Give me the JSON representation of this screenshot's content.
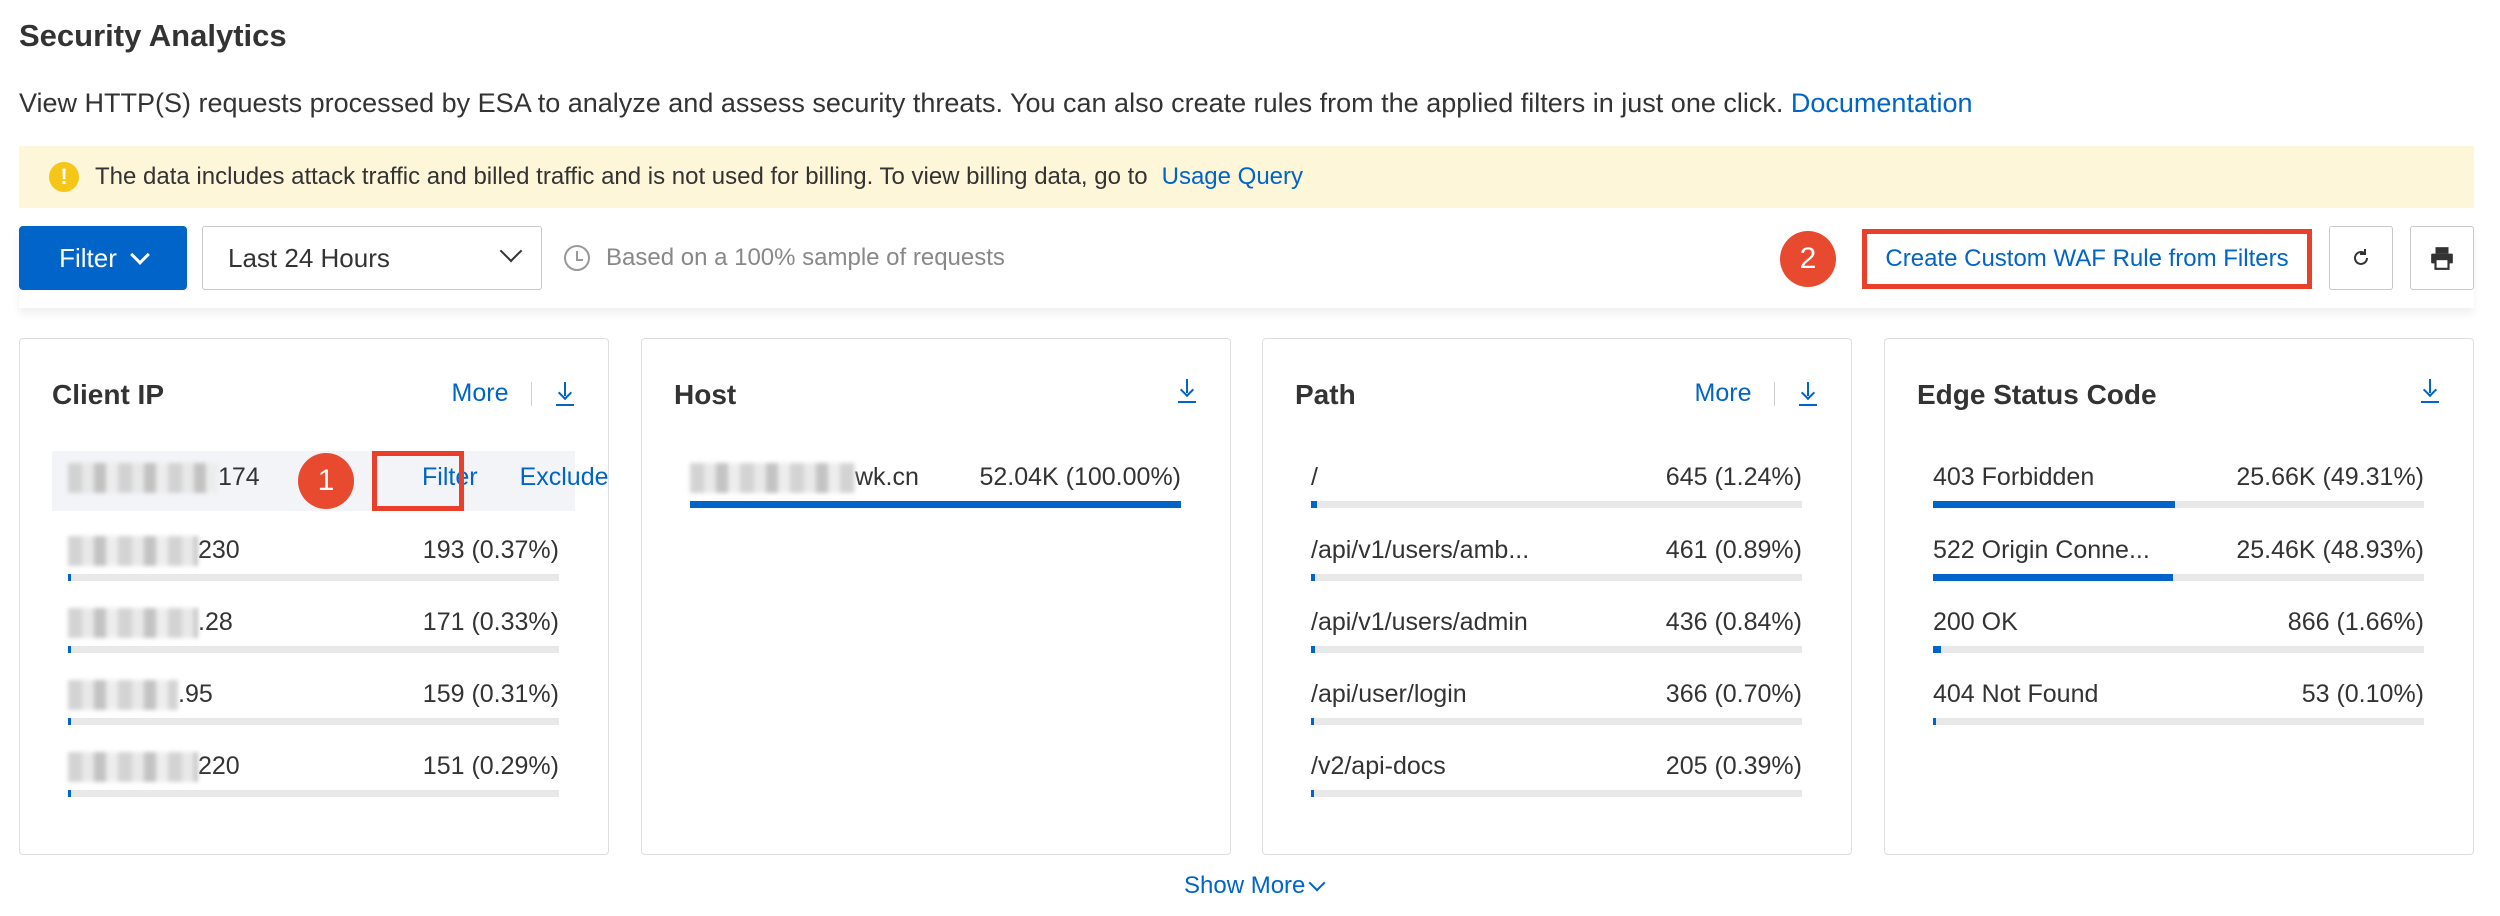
{
  "page": {
    "title": "Security Analytics",
    "description": "View HTTP(S) requests processed by ESA to analyze and assess security threats. You can also create rules from the applied filters in just one click.",
    "doc_link": "Documentation"
  },
  "notice": {
    "text": "The data includes attack traffic and billed traffic and is not used for billing. To view billing data, go to",
    "link": "Usage Query",
    "icon": "warning-icon"
  },
  "toolbar": {
    "filter_label": "Filter",
    "time_range": "Last 24 Hours",
    "sample_text": "Based on a 100% sample of requests",
    "create_rule_label": "Create Custom WAF Rule from Filters",
    "refresh_icon": "refresh-icon",
    "print_icon": "print-icon"
  },
  "markers": {
    "one": "1",
    "two": "2"
  },
  "colors": {
    "accent": "#0064c8",
    "marker": "#e84a2f",
    "notice_bg": "#fdf6d8"
  },
  "cards": {
    "client_ip": {
      "title": "Client IP",
      "more": "More",
      "row_filter": "Filter",
      "row_exclude": "Exclude",
      "rows": [
        {
          "label": "174",
          "value": "",
          "pct": 0
        },
        {
          "label": "230",
          "value": "193 (0.37%)",
          "pct": 0.37
        },
        {
          "label": ".28",
          "value": "171 (0.33%)",
          "pct": 0.33
        },
        {
          "label": ".95",
          "value": "159 (0.31%)",
          "pct": 0.31
        },
        {
          "label": "220",
          "value": "151 (0.29%)",
          "pct": 0.29
        }
      ]
    },
    "host": {
      "title": "Host",
      "rows": [
        {
          "label": "wk.cn",
          "value": "52.04K (100.00%)",
          "pct": 100
        }
      ]
    },
    "path": {
      "title": "Path",
      "more": "More",
      "rows": [
        {
          "label": "/",
          "value": "645 (1.24%)",
          "pct": 1.24
        },
        {
          "label": "/api/v1/users/amb...",
          "value": "461 (0.89%)",
          "pct": 0.89
        },
        {
          "label": "/api/v1/users/admin",
          "value": "436 (0.84%)",
          "pct": 0.84
        },
        {
          "label": "/api/user/login",
          "value": "366 (0.70%)",
          "pct": 0.7
        },
        {
          "label": "/v2/api-docs",
          "value": "205 (0.39%)",
          "pct": 0.39
        }
      ]
    },
    "edge_status": {
      "title": "Edge Status Code",
      "rows": [
        {
          "label": "403 Forbidden",
          "value": "25.66K (49.31%)",
          "pct": 49.31
        },
        {
          "label": "522 Origin Conne...",
          "value": "25.46K (48.93%)",
          "pct": 48.93
        },
        {
          "label": "200 OK",
          "value": "866 (1.66%)",
          "pct": 1.66
        },
        {
          "label": "404 Not Found",
          "value": "53 (0.10%)",
          "pct": 0.1
        }
      ]
    }
  },
  "show_more": "Show More"
}
